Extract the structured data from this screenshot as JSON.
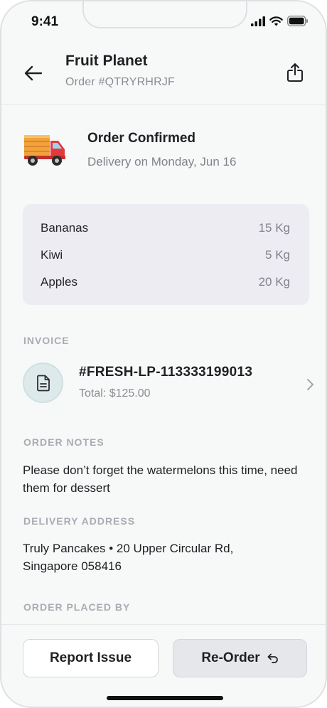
{
  "status_bar": {
    "time": "9:41"
  },
  "header": {
    "title": "Fruit Planet",
    "order_number": "Order #QTRYRHRJF"
  },
  "order_status": {
    "title": "Order Confirmed",
    "delivery": "Delivery on Monday, Jun 16"
  },
  "items": [
    {
      "name": "Bananas",
      "qty": "15 Kg"
    },
    {
      "name": "Kiwi",
      "qty": "5 Kg"
    },
    {
      "name": "Apples",
      "qty": "20 Kg"
    }
  ],
  "invoice": {
    "label": "INVOICE",
    "number": "#FRESH-LP-113333199013",
    "total": "Total: $125.00"
  },
  "order_notes": {
    "label": "ORDER NOTES",
    "text": "Please don’t forget the watermelons this time, need them for dessert"
  },
  "delivery_address": {
    "label": "DELIVERY ADDRESS",
    "line1": "Truly Pancakes • 20 Upper Circular Rd,",
    "line2": "Singapore 058416"
  },
  "order_placed_by": {
    "label": "ORDER PLACED BY"
  },
  "footer": {
    "report_label": "Report Issue",
    "reorder_label": "Re-Order"
  },
  "icons": {
    "back": "arrow-left-icon",
    "share": "share-icon",
    "truck": "delivery-truck-icon",
    "invoice": "document-icon",
    "chevron": "chevron-right-icon",
    "reorder": "undo-arrow-icon"
  },
  "colors": {
    "background": "#f7f8f8",
    "items_card": "#ececf2",
    "invoice_icon_bg": "#dde9ea",
    "muted_text": "#8a8d94"
  }
}
